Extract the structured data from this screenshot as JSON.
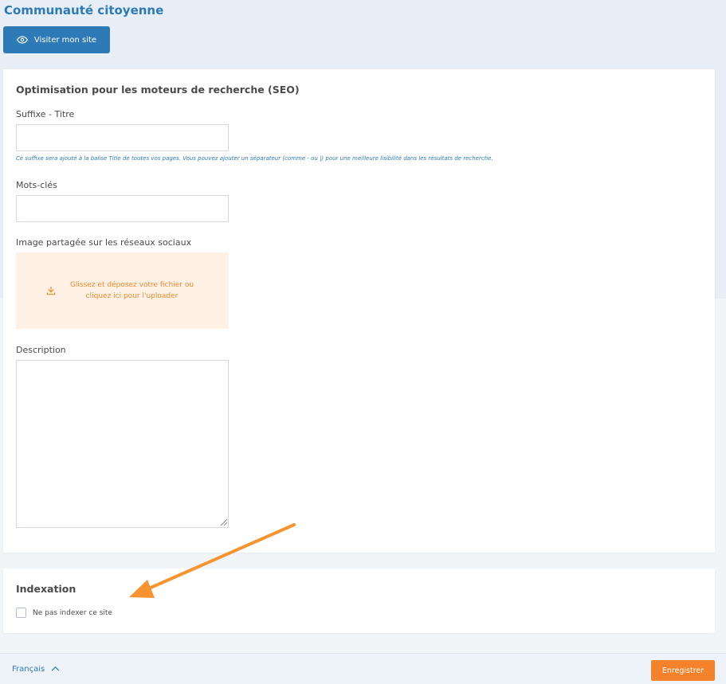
{
  "header": {
    "site_title": "Communauté citoyenne",
    "visit_button_label": "Visiter mon site",
    "visit_button_icon": "eye-icon"
  },
  "seo": {
    "title": "Optimisation pour les moteurs de recherche (SEO)",
    "suffix_label": "Suffixe - Titre",
    "suffix_value": "",
    "suffix_help": "Ce suffixe sera ajouté à la balise Title de toutes vos pages. Vous pouvez ajouter un séparateur (comme - ou |) pour une meilleure lisibilité dans les résultats de recherche.",
    "keywords_label": "Mots-clés",
    "keywords_value": "",
    "image_label": "Image partagée sur les réseaux sociaux",
    "dropzone_icon": "download-icon",
    "dropzone_line1": "Glissez et déposez votre fichier ou",
    "dropzone_line2": "cliquez ici pour l'uploader",
    "description_label": "Description",
    "description_value": ""
  },
  "indexation": {
    "title": "Indexation",
    "noindex_label": "Ne pas indexer ce site",
    "noindex_checked": false
  },
  "footer": {
    "language_label": "Français",
    "language_icon": "chevron-up-icon",
    "save_label": "Enregistrer"
  },
  "colors": {
    "primary": "#2d7ab7",
    "accent": "#f5822a",
    "dropzone_bg": "#fff1e6",
    "annotation_arrow": "#f7942f"
  }
}
